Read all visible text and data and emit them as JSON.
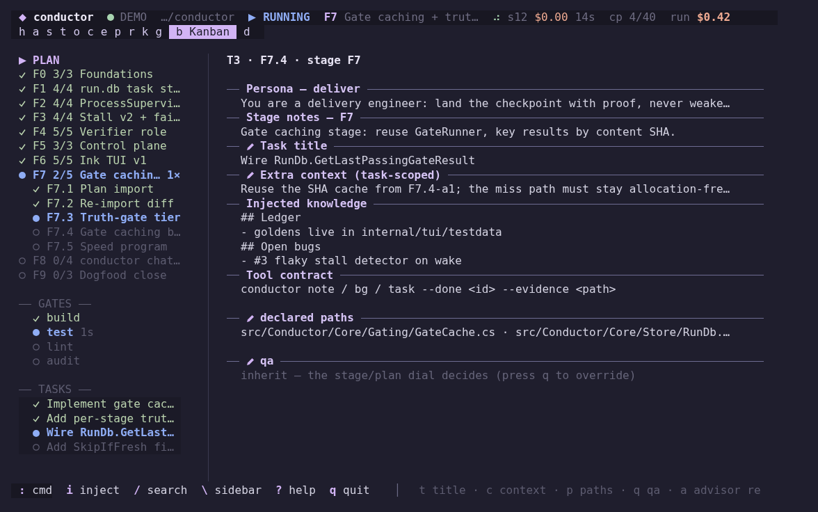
{
  "header": {
    "app": "conductor",
    "mode": "DEMO",
    "path": "…/conductor",
    "state": "RUNNING",
    "stage": "F7",
    "stage_title": "Gate caching + trut…",
    "spinner": "⠴",
    "session": "s12",
    "session_cost": "$0.00",
    "elapsed": "14s",
    "checkpoint": "cp 4/40",
    "run_label": "run",
    "run_cost": "$0.42"
  },
  "tabs": [
    {
      "label": "h",
      "selected": false
    },
    {
      "label": "a",
      "selected": false
    },
    {
      "label": "s",
      "selected": false
    },
    {
      "label": "t",
      "selected": false
    },
    {
      "label": "o",
      "selected": false
    },
    {
      "label": "c",
      "selected": false
    },
    {
      "label": "e",
      "selected": false
    },
    {
      "label": "p",
      "selected": false
    },
    {
      "label": "r",
      "selected": false
    },
    {
      "label": "k",
      "selected": false
    },
    {
      "label": "g",
      "selected": false
    },
    {
      "label": "b Kanban",
      "selected": true
    },
    {
      "label": "d",
      "selected": false
    }
  ],
  "sidebar": {
    "plan_title": "PLAN",
    "plan": [
      {
        "kind": "done",
        "id": "F0",
        "progress": "3/3",
        "title": "Foundations"
      },
      {
        "kind": "done",
        "id": "F1",
        "progress": "4/4",
        "title": "run.db task st…"
      },
      {
        "kind": "done",
        "id": "F2",
        "progress": "4/4",
        "title": "ProcessSupervi…"
      },
      {
        "kind": "done",
        "id": "F3",
        "progress": "4/4",
        "title": "Stall v2 + fai…"
      },
      {
        "kind": "done",
        "id": "F4",
        "progress": "5/5",
        "title": "Verifier role"
      },
      {
        "kind": "done",
        "id": "F5",
        "progress": "3/3",
        "title": "Control plane"
      },
      {
        "kind": "done",
        "id": "F6",
        "progress": "5/5",
        "title": "Ink TUI v1"
      },
      {
        "kind": "active",
        "id": "F7",
        "progress": "2/5",
        "title": "Gate cachin…",
        "retries": "1×",
        "children": [
          {
            "kind": "done",
            "id": "F7.1",
            "title": "Plan import"
          },
          {
            "kind": "done",
            "id": "F7.2",
            "title": "Re-import diff"
          },
          {
            "kind": "active",
            "id": "F7.3",
            "title": "Truth-gate tier"
          },
          {
            "kind": "pending",
            "id": "F7.4",
            "title": "Gate caching b…"
          },
          {
            "kind": "pending",
            "id": "F7.5",
            "title": "Speed program"
          }
        ]
      },
      {
        "kind": "pending",
        "id": "F8",
        "progress": "0/4",
        "title": "conductor chat…"
      },
      {
        "kind": "pending",
        "id": "F9",
        "progress": "0/3",
        "title": "Dogfood close"
      }
    ],
    "gates_title": "GATES",
    "gates": [
      {
        "kind": "done",
        "name": "build"
      },
      {
        "kind": "active",
        "name": "test",
        "time": "1s"
      },
      {
        "kind": "pending",
        "name": "lint"
      },
      {
        "kind": "pending",
        "name": "audit"
      }
    ],
    "tasks_title": "TASKS",
    "tasks": [
      {
        "kind": "done",
        "title": "Implement gate cac…"
      },
      {
        "kind": "done",
        "title": "Add per-stage trut…"
      },
      {
        "kind": "active",
        "title": "Wire RunDb.GetLast…"
      },
      {
        "kind": "pending",
        "title": "Add SkipIfFresh fi…"
      }
    ]
  },
  "main": {
    "title": "T3 · F7.4 · stage F7",
    "sections": [
      {
        "heading": "Persona — deliver",
        "editable": false,
        "separated": false,
        "dim": false,
        "lines": [
          "You are a delivery engineer: land the checkpoint with proof, never weake…"
        ]
      },
      {
        "heading": "Stage notes — F7",
        "editable": false,
        "separated": false,
        "dim": false,
        "lines": [
          "Gate caching stage: reuse GateRunner, key results by content SHA."
        ]
      },
      {
        "heading": "Task title",
        "editable": true,
        "separated": false,
        "dim": false,
        "lines": [
          "Wire RunDb.GetLastPassingGateResult"
        ]
      },
      {
        "heading": "Extra context (task-scoped)",
        "editable": true,
        "separated": false,
        "dim": false,
        "lines": [
          "Reuse the SHA cache from F7.4-a1; the miss path must stay allocation-fre…"
        ]
      },
      {
        "heading": "Injected knowledge",
        "editable": false,
        "separated": false,
        "dim": false,
        "lines": [
          "## Ledger",
          "- goldens live in internal/tui/testdata",
          "## Open bugs",
          "- #3 flaky stall detector on wake"
        ]
      },
      {
        "heading": "Tool contract",
        "editable": false,
        "separated": false,
        "dim": false,
        "lines": [
          "conductor note / bg / task --done <id> --evidence <path>"
        ]
      },
      {
        "heading": "declared paths",
        "editable": true,
        "separated": true,
        "dim": false,
        "lines": [
          "src/Conductor/Core/Gating/GateCache.cs · src/Conductor/Core/Store/RunDb.…"
        ]
      },
      {
        "heading": "qa",
        "editable": true,
        "separated": true,
        "dim": true,
        "lines": [
          "inherit — the stage/plan dial decides (press q to override)"
        ]
      }
    ]
  },
  "footer": {
    "keys": [
      {
        "key": ":",
        "label": "cmd"
      },
      {
        "key": "i",
        "label": "inject"
      },
      {
        "key": "/",
        "label": "search"
      },
      {
        "key": "\\",
        "label": "sidebar"
      },
      {
        "key": "?",
        "label": "help"
      },
      {
        "key": "q",
        "label": "quit"
      }
    ],
    "separator": "│",
    "hints": "t title · c context · p paths · q qa · a advisor re"
  }
}
